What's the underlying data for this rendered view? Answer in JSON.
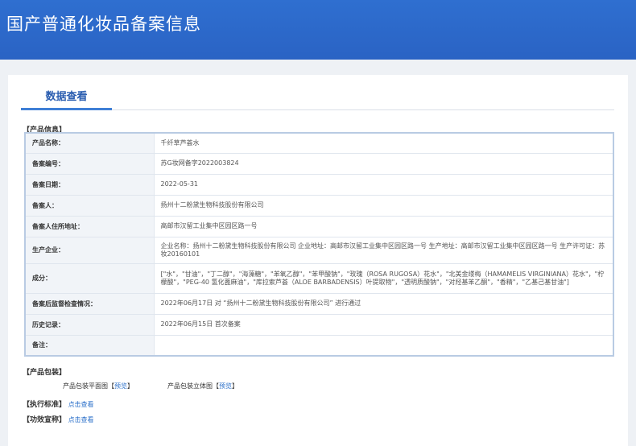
{
  "header": {
    "title": "国产普通化妆品备案信息"
  },
  "tab": {
    "label": "数据查看"
  },
  "sections": {
    "product_info": "【产品信息】",
    "product_package": "【产品包装】",
    "standard": "【执行标准】",
    "efficacy": "【功效宣称】"
  },
  "rows": [
    {
      "key": "产品名称：",
      "value": "千纤草芦荟水"
    },
    {
      "key": "备案编号：",
      "value": "苏G妆网备字2022003824"
    },
    {
      "key": "备案日期：",
      "value": "2022-05-31"
    },
    {
      "key": "备案人：",
      "value": "扬州十二粉黛生物科技股份有限公司"
    },
    {
      "key": "备案人住所地址：",
      "value": "高邮市汉留工业集中区园区路一号"
    },
    {
      "key": "生产企业：",
      "value": "企业名称：扬州十二粉黛生物科技股份有限公司 企业地址：高邮市汉留工业集中区园区路一号 生产地址：高邮市汉留工业集中区园区路一号 生产许可证：苏妆20160101"
    },
    {
      "key": "成分：",
      "value": "[\"水\"，\"甘油\"，\"丁二醇\"，\"海藻糖\"，\"苯氧乙醇\"，\"苯甲酸钠\"，\"玫瑰（ROSA RUGOSA）花水\"，\"北美金缕梅（HAMAMELIS VIRGINIANA）花水\"，\"柠檬酸\"，\"PEG-40 氢化蓖麻油\"，\"库拉索芦荟（ALOE BARBADENSIS）叶提取物\"，\"透明质酸钠\"，\"对羟基苯乙酮\"，\"香精\"，\"乙基己基甘油\"]"
    },
    {
      "key": "备案后监督检查情况：",
      "value": "2022年06月17日 对 “扬州十二粉黛生物科技股份有限公司” 进行通过"
    },
    {
      "key": "历史记录：",
      "value": "2022年06月15日 首次备案"
    },
    {
      "key": "备注：",
      "value": ""
    }
  ],
  "package": {
    "flat_label": "产品包装平面图",
    "stereo_label": "产品包装立体图",
    "bracket_open": "【",
    "bracket_close": "】",
    "preview": "预览"
  },
  "more_link": "点击查看",
  "colors": {
    "header": "#2f6fd0",
    "accent": "#3f7fd6",
    "link": "#2a6fc9"
  }
}
